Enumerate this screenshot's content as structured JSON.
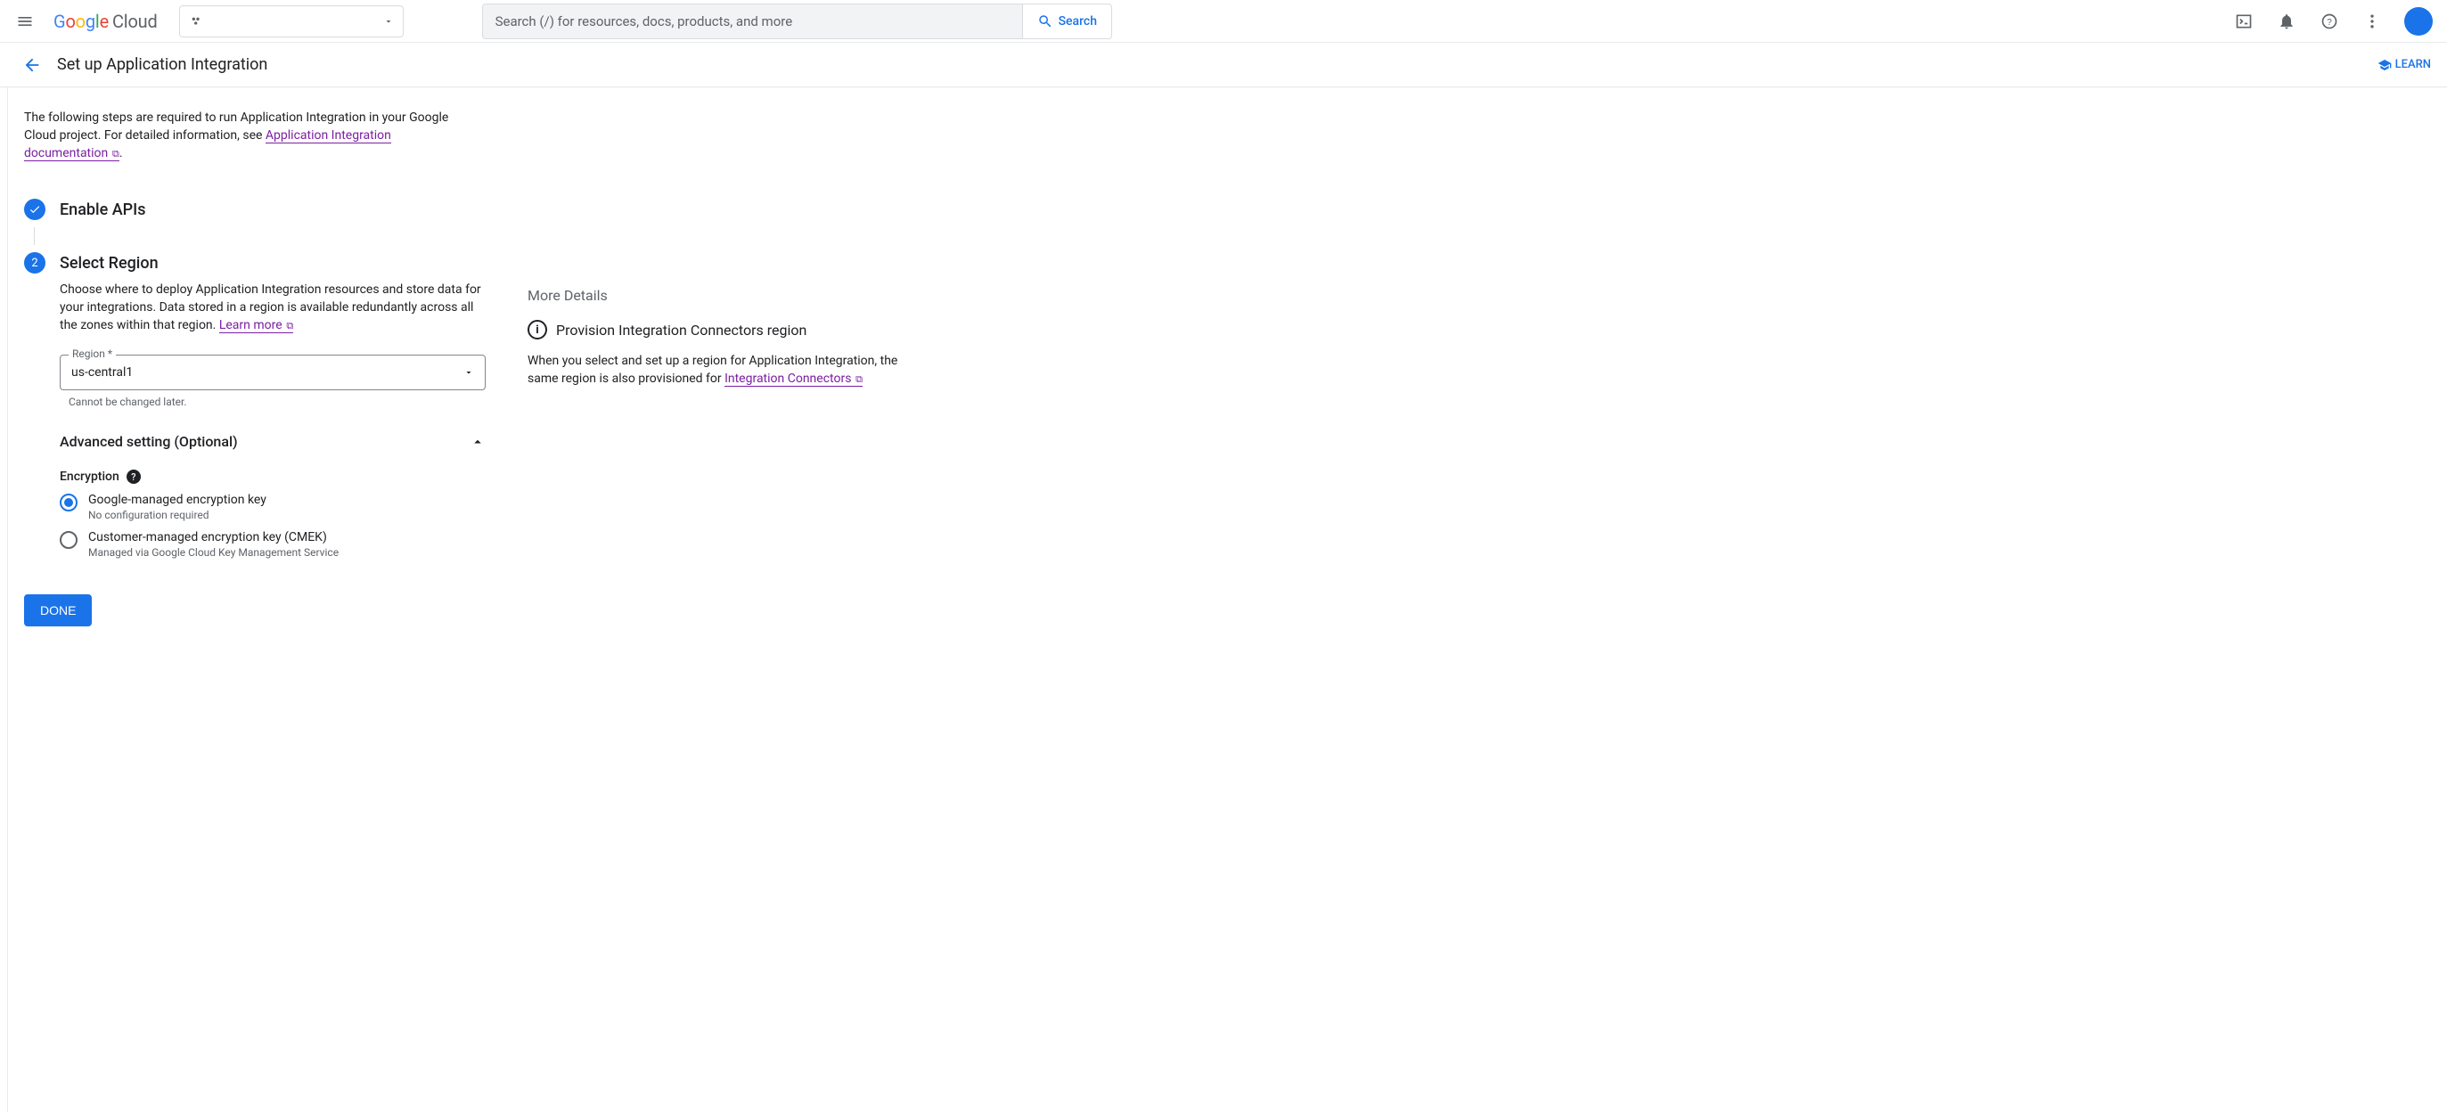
{
  "header": {
    "logo_word": "Google",
    "logo_cloud": "Cloud",
    "search_placeholder": "Search (/) for resources, docs, products, and more",
    "search_button": "Search"
  },
  "subheader": {
    "title": "Set up Application Integration",
    "learn": "LEARN"
  },
  "intro": {
    "text_a": "The following steps are required to run Application Integration in your Google Cloud project. For detailed information, see ",
    "link": "Application Integration documentation",
    "text_b": "."
  },
  "step1": {
    "title": "Enable APIs"
  },
  "step2": {
    "num": "2",
    "title": "Select Region",
    "desc_a": "Choose where to deploy Application Integration resources and store data for your integrations. Data stored in a region is available redundantly across all the zones within that region. ",
    "learn_more": "Learn more",
    "region_label": "Region *",
    "region_value": "us-central1",
    "region_helper": "Cannot be changed later.",
    "advanced_title": "Advanced setting (Optional)",
    "encryption_label": "Encryption",
    "radio1_main": "Google-managed encryption key",
    "radio1_sub": "No configuration required",
    "radio2_main": "Customer-managed encryption key (CMEK)",
    "radio2_sub": "Managed via Google Cloud Key Management Service"
  },
  "done": "DONE",
  "details": {
    "title": "More Details",
    "row_title": "Provision Integration Connectors region",
    "text_a": "When you select and set up a region for Application Integration, the same region is also provisioned for ",
    "link": "Integration Connectors"
  }
}
